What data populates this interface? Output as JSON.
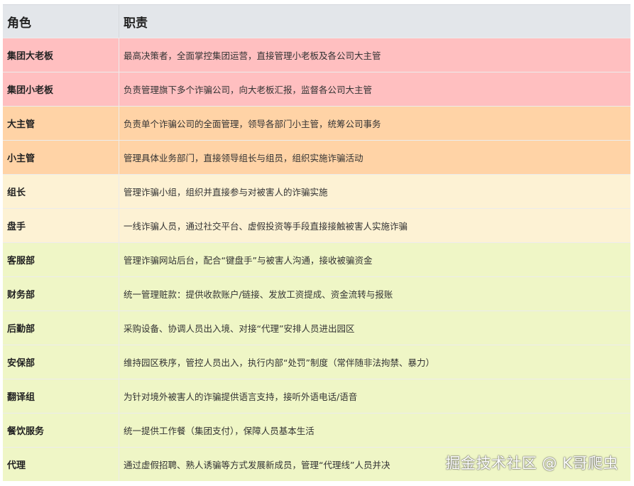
{
  "header": {
    "role": "角色",
    "duty": "职责"
  },
  "rows": [
    {
      "role": "集团大老板",
      "duty": "最高决策者，全面掌控集团运营，直接管理小老板及各公司大主管",
      "color": "#ffbfc0"
    },
    {
      "role": "集团小老板",
      "duty": "负责管理旗下多个诈骗公司，向大老板汇报，监督各公司大主管",
      "color": "#ffbfc0"
    },
    {
      "role": "大主管",
      "duty": "负责单个诈骗公司的全面管理，领导各部门小主管，统筹公司事务",
      "color": "#ffd3a6"
    },
    {
      "role": "小主管",
      "duty": "管理具体业务部门，直接领导组长与组员，组织实施诈骗活动",
      "color": "#ffd3a6"
    },
    {
      "role": "组长",
      "duty": "管理诈骗小组，组织并直接参与对被害人的诈骗实施",
      "color": "#fdf2d4"
    },
    {
      "role": "盘手",
      "duty": "一线诈骗人员，通过社交平台、虚假投资等手段直接接触被害人实施诈骗",
      "color": "#fdf2d4"
    },
    {
      "role": "客服部",
      "duty": "管理诈骗网站后台，配合“键盘手”与被害人沟通，接收被骗资金",
      "color": "#eff6c6"
    },
    {
      "role": "财务部",
      "duty": "统一管理赃款：提供收款账户/链接、发放工资提成、资金流转与报账",
      "color": "#eff6c6"
    },
    {
      "role": "后勤部",
      "duty": "采购设备、协调人员出入境、对接“代理”安排人员进出园区",
      "color": "#eff6c6"
    },
    {
      "role": "安保部",
      "duty": "维持园区秩序，管控人员出入，执行内部“处罚”制度（常伴随非法拘禁、暴力）",
      "color": "#eff6c6"
    },
    {
      "role": "翻译组",
      "duty": "为针对境外被害人的诈骗提供语言支持，接听外语电话/语音",
      "color": "#eff6c6"
    },
    {
      "role": "餐饮服务",
      "duty": "统一提供工作餐（集团支付），保障人员基本生活",
      "color": "#eff6c6"
    },
    {
      "role": "代理",
      "duty": "通过虚假招聘、熟人诱骗等方式发展新成员，管理“代理线”人员并决",
      "color": "#eff6c6"
    }
  ],
  "watermark": "掘金技术社区 @ K哥爬虫"
}
